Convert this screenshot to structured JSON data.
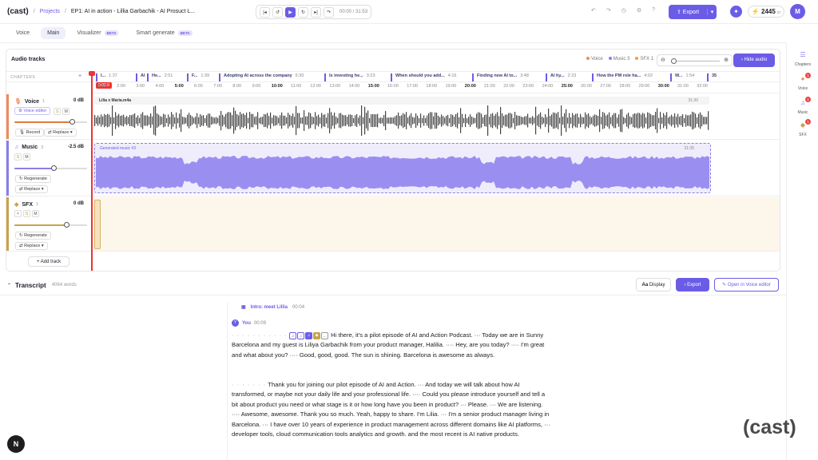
{
  "header": {
    "logo": "(cast)",
    "sep1": "/",
    "projects": "Projects",
    "sep2": "/",
    "episode": "EP1: AI in action - Lillia Garbachik - AI Prosuct L...",
    "time": "00:00 / 31:53",
    "export": "Export",
    "credits": "2445",
    "credits_suffix": "cr",
    "avatar": "M"
  },
  "tabs": [
    {
      "label": "Voice"
    },
    {
      "label": "Main",
      "active": true
    },
    {
      "label": "Visualizer",
      "badge": "BETA"
    },
    {
      "label": "Smart generate",
      "badge": "BETA"
    }
  ],
  "right_sidebar": [
    {
      "label": "Chapters",
      "icon": "chapters-icon"
    },
    {
      "label": "Voice",
      "icon": "mic-icon",
      "badge": "1"
    },
    {
      "label": "Music",
      "icon": "music-icon",
      "badge": "1"
    },
    {
      "label": "SFX",
      "icon": "sfx-icon",
      "badge": "1"
    }
  ],
  "audio": {
    "title": "Audio tracks",
    "legend": [
      {
        "label": "Voice",
        "color": "#f08a5d"
      },
      {
        "label": "Music 3",
        "color": "#8a7fe8"
      },
      {
        "label": "SFX 1",
        "color": "#f0a040"
      }
    ],
    "hide_audio": "Hide audio",
    "chapters_label": "CHAPTERS",
    "playhead": "0:00.0"
  },
  "chapters": [
    {
      "name": "I...",
      "time": "1:37"
    },
    {
      "name": "AI",
      "time": ""
    },
    {
      "name": "He...",
      "time": "2:51"
    },
    {
      "name": "F...",
      "time": "1:39"
    },
    {
      "name": "Adopting AI across the company",
      "time": "5:30"
    },
    {
      "name": "Is investing he...",
      "time": "3:23"
    },
    {
      "name": "When should you add...",
      "time": "4:16"
    },
    {
      "name": "Finding new AI to...",
      "time": "3:48"
    },
    {
      "name": "AI hy...",
      "time": "2:23"
    },
    {
      "name": "How the PM role ha...",
      "time": "4:02"
    },
    {
      "name": "W...",
      "time": "1:54"
    },
    {
      "name": "35",
      "time": ""
    }
  ],
  "ruler": [
    "1:00",
    "2:00",
    "3:00",
    "4:00",
    "5:00",
    "6:00",
    "7:00",
    "8:00",
    "9:00",
    "10:00",
    "11:00",
    "12:00",
    "13:00",
    "14:00",
    "15:00",
    "16:00",
    "17:00",
    "18:00",
    "19:00",
    "20:00",
    "21:00",
    "22:00",
    "23:00",
    "24:00",
    "25:00",
    "26:00",
    "27:00",
    "28:00",
    "29:00",
    "30:00",
    "31:00",
    "32:00"
  ],
  "tracks": {
    "voice": {
      "name": "Voice",
      "num": "1",
      "db": "0 dB",
      "editor": "Voice editor",
      "s": "S",
      "m": "M",
      "record": "Record",
      "replace": "Replace",
      "clip": "Lilia x Maria.m4a",
      "clip_end": "31:30",
      "level": 0.8
    },
    "music": {
      "name": "Music",
      "num": "3",
      "db": "-2.5 dB",
      "s": "S",
      "m": "M",
      "regen": "Regenerate",
      "replace": "Replace",
      "clip": "Generated music #3",
      "clip_end": "31:35",
      "level": 0.55
    },
    "sfx": {
      "name": "SFX",
      "num": "1",
      "db": "0 dB",
      "x": "×",
      "s": "S",
      "m": "M",
      "regen": "Regenerate",
      "replace": "Replace",
      "level": 0.72
    }
  },
  "add_track": "+  Add track",
  "transcript": {
    "title": "Transcript",
    "words": "4064 words",
    "display": "Display",
    "export": "Export",
    "open": "Open in Voice editor",
    "section": "Intro: meet Lillia",
    "section_time": "00:04",
    "speaker": "You",
    "speaker_time": "00:09",
    "speaker_initial": "Y",
    "p1": "Hi there, it's a pilot episode of AI and Action Podcast.  ···  Today we are in Sunny Barcelona and my guest is Liliya Garbachik from your product manager, Halilia.  ····  Hey, are you today?  ····  I'm great and what about you?  ····  Good, good, good. The sun is shining. Barcelona is awesome as always.",
    "p2": "Thank you for joining our pilot episode of AI and Action.  ···  And today we will talk about how AI transformed, or maybe not your daily life and your professional life.  ····  Could you please introduce yourself and tell a bit about product you need or what stage is it or how long have you been in product?  ···  Please.  ···  We are listening.  ····  Awesome, awesome. Thank you so much. Yeah, happy to share. I'm Lilia.  ···  I'm a senior product manager living in Barcelona.  ···  I have over 10 years of experience in product management across different domains like AI platforms,  ···  developer tools, cloud communication tools analytics and growth. and the most recent is AI native products."
  },
  "watermark": "(cast)",
  "n_button": "N"
}
